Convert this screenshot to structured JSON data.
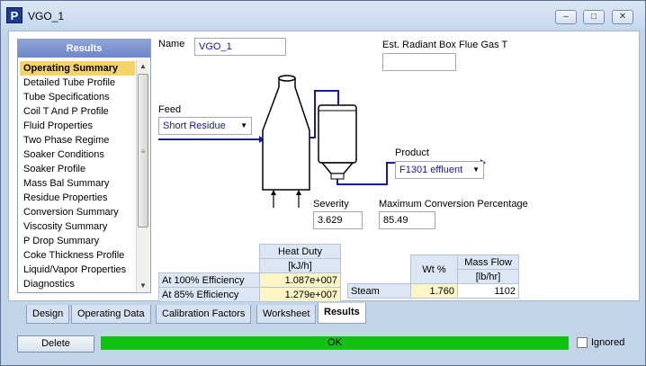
{
  "window": {
    "title": "VGO_1",
    "app_icon": "P",
    "min": "–",
    "max": "□",
    "close": "✕"
  },
  "nav": {
    "header": "Results",
    "items": [
      "Operating Summary",
      "Detailed Tube Profile",
      "Tube Specifications",
      "Coil T And P Profile",
      "Fluid Properties",
      "Two Phase Regime",
      "Soaker Conditions",
      "Soaker Profile",
      "Mass Bal Summary",
      "Residue Properties",
      "Conversion Summary",
      "Viscosity Summary",
      "P Drop Summary",
      "Coke Thickness Profile",
      "Liquid/Vapor Properties",
      "Diagnostics"
    ],
    "selected_index": 0
  },
  "form": {
    "name_label": "Name",
    "name_value": "VGO_1",
    "flue_label": "Est. Radiant Box Flue Gas T",
    "flue_value": "",
    "feed_label": "Feed",
    "feed_value": "Short Residue",
    "product_label": "Product",
    "product_value": "F1301 effluent",
    "severity_label": "Severity",
    "severity_value": "3.629",
    "conversion_label": "Maximum Conversion Percentage",
    "conversion_value": "85.49"
  },
  "heat_duty": {
    "header": "Heat Duty",
    "unit": "[kJ/h]",
    "rows": [
      {
        "label": "At 100% Efficiency",
        "value": "1.087e+007"
      },
      {
        "label": "At 85% Efficiency",
        "value": "1.279e+007"
      }
    ]
  },
  "steam": {
    "col1_header": "Wt %",
    "col2_header": "Mass Flow",
    "col2_unit": "[lb/hr]",
    "row_label": "Steam",
    "wt": "1.760",
    "flow": "1102"
  },
  "tabs": [
    "Design",
    "Operating Data",
    "Calibration Factors",
    "Worksheet",
    "Results"
  ],
  "active_tab": "Results",
  "footer": {
    "delete_label": "Delete",
    "status_text": "OK",
    "ignored_label": "Ignored",
    "ignored_checked": false
  },
  "colors": {
    "status_ok": "#11c211",
    "nav_header": "#7a90cc",
    "selected_item": "#f4d36a",
    "stream_line": "#1a1a9c"
  }
}
